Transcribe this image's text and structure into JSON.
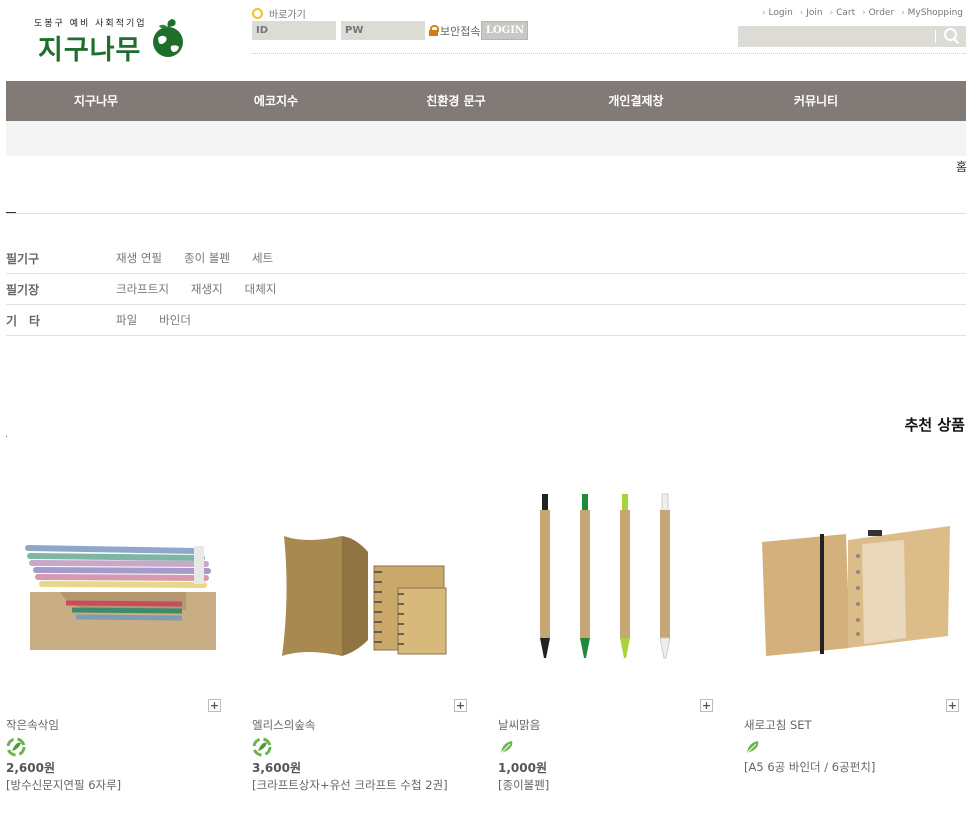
{
  "header": {
    "logo_sub": "도봉구 예비 사회적기업",
    "logo_main": "지구나무",
    "quick_go": "바로가기",
    "id_placeholder": "ID",
    "pw_placeholder": "PW",
    "secure_label": "보안접속",
    "login_button": "LOGIN",
    "util_links": [
      "Login",
      "Join",
      "Cart",
      "Order",
      "MyShopping"
    ],
    "search_value": ""
  },
  "main_nav": [
    "지구나무",
    "에코지수",
    "친환경 문구",
    "개인결제창",
    "커뮤니티"
  ],
  "breadcrumb_home": "홈",
  "categories": [
    {
      "title": "필기구",
      "links": [
        "재생 연필",
        "종이 볼펜",
        "세트"
      ]
    },
    {
      "title": "필기장",
      "links": [
        "크라프트지",
        "재생지",
        "대체지"
      ]
    },
    {
      "title": "기　타",
      "links": [
        "파일",
        "바인더"
      ]
    }
  ],
  "recommend_title": "추천 상품",
  "products": [
    {
      "name": "작은속삭임",
      "price": "2,600원",
      "desc": "[방수신문지연필 6자루]"
    },
    {
      "name": "엘리스의숲속",
      "price": "3,600원",
      "desc": "[크라프트상자+유선 크라프트 수첩 2권]"
    },
    {
      "name": "날씨맑음",
      "price": "1,000원",
      "desc": "[종이볼펜]"
    },
    {
      "name": "새로고침 SET",
      "price": "",
      "desc": "[A5 6공 바인더 / 6공펀치]"
    }
  ],
  "colors": {
    "nav_bg": "#817a76",
    "logo_green": "#1f6e2c",
    "field_bg": "#dcdbd6"
  }
}
